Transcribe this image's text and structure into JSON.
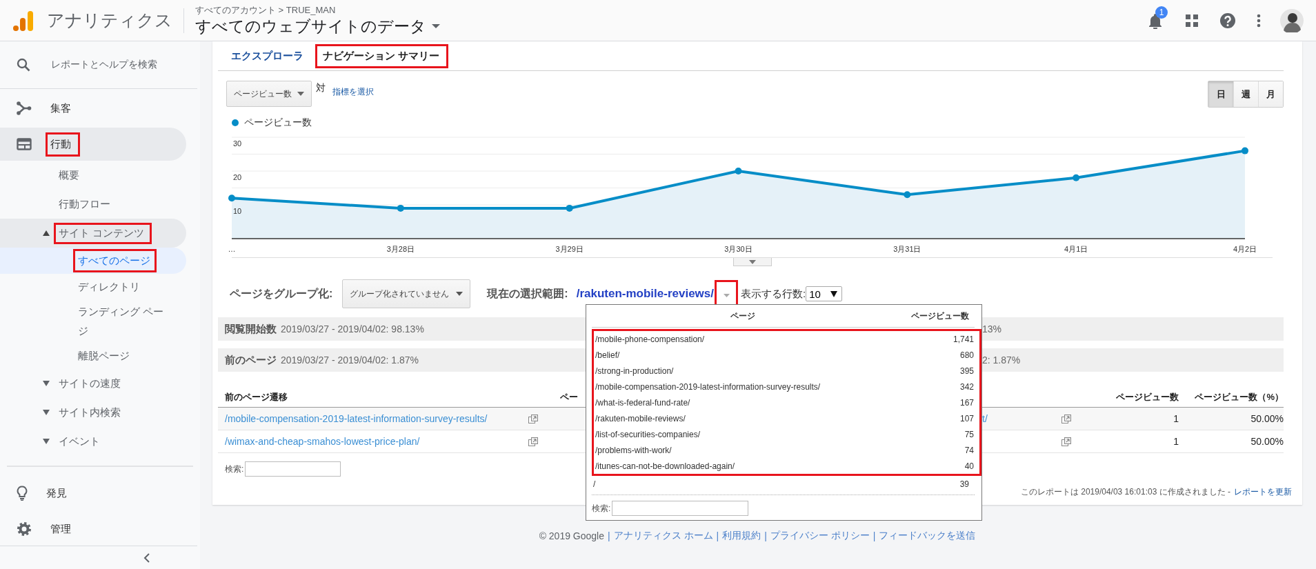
{
  "header": {
    "app_name": "アナリティクス",
    "breadcrumb": "すべてのアカウント > TRUE_MAN",
    "property": "すべてのウェブサイトのデータ",
    "notification_count": "1"
  },
  "sidebar": {
    "search": "レポートとヘルプを検索",
    "items": [
      {
        "label": "集客",
        "selected": false,
        "highlighted": false
      },
      {
        "label": "行動",
        "selected": true,
        "highlighted": true,
        "children": [
          {
            "label": "概要",
            "selected": false,
            "highlighted": false
          },
          {
            "label": "行動フロー",
            "selected": false,
            "highlighted": false
          },
          {
            "label": "サイト コンテンツ",
            "selected": true,
            "highlighted": true,
            "expanded": true,
            "children": [
              {
                "label": "すべてのページ",
                "selected": true,
                "highlighted": true
              },
              {
                "label": "ディレクトリ",
                "selected": false,
                "highlighted": false
              },
              {
                "label": "ランディング ページ",
                "selected": false,
                "highlighted": false
              },
              {
                "label": "離脱ページ",
                "selected": false,
                "highlighted": false
              }
            ]
          },
          {
            "label": "サイトの速度",
            "selected": false,
            "highlighted": false,
            "expanded": false
          },
          {
            "label": "サイト内検索",
            "selected": false,
            "highlighted": false,
            "expanded": false
          },
          {
            "label": "イベント",
            "selected": false,
            "highlighted": false,
            "expanded": false
          }
        ]
      }
    ],
    "bottom_items": [
      {
        "label": "発見",
        "selected": false
      },
      {
        "label": "管理",
        "selected": false
      }
    ]
  },
  "report": {
    "tabs": [
      {
        "label": "エクスプローラ",
        "selected": false,
        "highlighted": false
      },
      {
        "label": "ナビゲーション サマリー",
        "selected": true,
        "highlighted": true
      }
    ],
    "metric_select": "ページビュー数",
    "versus": "対",
    "choose_metric": "指標を選択",
    "periods": [
      {
        "label": "日",
        "selected": true
      },
      {
        "label": "週",
        "selected": false
      },
      {
        "label": "月",
        "selected": false
      }
    ],
    "chart_data": {
      "type": "area",
      "categories": [
        "…",
        "3月28日",
        "3月29日",
        "3月30日",
        "3月31日",
        "4月1日",
        "4月2日"
      ],
      "ylim": [
        0,
        30
      ],
      "yticks": [
        10,
        20,
        30
      ],
      "series": [
        {
          "name": "ページビュー数",
          "color": "#058dc7",
          "marker": true,
          "values": [
            12,
            9,
            9,
            20,
            13,
            18,
            26
          ]
        }
      ]
    },
    "group_label": "ページをグループ化:",
    "group_select": "グループ化されていません",
    "selection_label": "現在の選択範囲:",
    "selection": "/rakuten-mobile-reviews/",
    "selection_toggle_highlighted": true,
    "rows_label": "表示する行数:",
    "rows_select": "10",
    "summary": [
      {
        "label": "閲覧開始数",
        "text": "2019/03/27 - 2019/04/02: 98.13%",
        "tail": "13%"
      },
      {
        "label": "前のページ",
        "text": "2019/03/27 - 2019/04/02: 1.87%",
        "tail": "2: 1.87%"
      }
    ],
    "table": {
      "columns": [
        "前のページ遷移",
        "ペー",
        "ページビュー数",
        "ページビュー数（%）"
      ],
      "rows": [
        {
          "previous_page": "/mobile-compensation-2019-latest-information-survey-results/",
          "next_page": "t/",
          "pageviews": "1",
          "percent": "50.00%"
        },
        {
          "previous_page": "/wimax-and-cheap-smahos-lowest-price-plan/",
          "pageviews": "1",
          "percent": "50.00%"
        }
      ]
    },
    "search_label": "検索:",
    "popup": {
      "columns": [
        "ページ",
        "ページビュー数"
      ],
      "rows": [
        {
          "page": "/mobile-phone-compensation/",
          "pageviews": "1,741",
          "selected": false,
          "highlighted": true
        },
        {
          "page": "/belief/",
          "pageviews": "680",
          "selected": false,
          "highlighted": true
        },
        {
          "page": "/strong-in-production/",
          "pageviews": "395",
          "selected": false,
          "highlighted": true
        },
        {
          "page": "/mobile-compensation-2019-latest-information-survey-results/",
          "pageviews": "342",
          "selected": false,
          "highlighted": true
        },
        {
          "page": "/what-is-federal-fund-rate/",
          "pageviews": "167",
          "selected": false,
          "highlighted": true
        },
        {
          "page": "/rakuten-mobile-reviews/",
          "pageviews": "107",
          "selected": false,
          "highlighted": true
        },
        {
          "page": "/list-of-securities-companies/",
          "pageviews": "75",
          "selected": false,
          "highlighted": true
        },
        {
          "page": "/problems-with-work/",
          "pageviews": "74",
          "selected": false,
          "highlighted": true
        },
        {
          "page": "/itunes-can-not-be-downloaded-again/",
          "pageviews": "40",
          "selected": false,
          "highlighted": true
        },
        {
          "page": "/",
          "pageviews": "39",
          "selected": false,
          "highlighted": false
        }
      ],
      "search_label": "検索:"
    },
    "note": "このレポートは 2019/04/03 16:01:03 に作成されました -",
    "refresh": "レポートを更新"
  },
  "footer": [
    {
      "kind": "text",
      "text": "© 2019 Google"
    },
    {
      "kind": "separator",
      "text": "|"
    },
    {
      "kind": "link",
      "text": "アナリティクス ホーム"
    },
    {
      "kind": "separator",
      "text": "|"
    },
    {
      "kind": "link",
      "text": "利用規約"
    },
    {
      "kind": "separator",
      "text": "|"
    },
    {
      "kind": "link",
      "text": "プライバシー ポリシー"
    },
    {
      "kind": "separator",
      "text": "|"
    },
    {
      "kind": "link",
      "text": "フィードバックを送信"
    }
  ]
}
